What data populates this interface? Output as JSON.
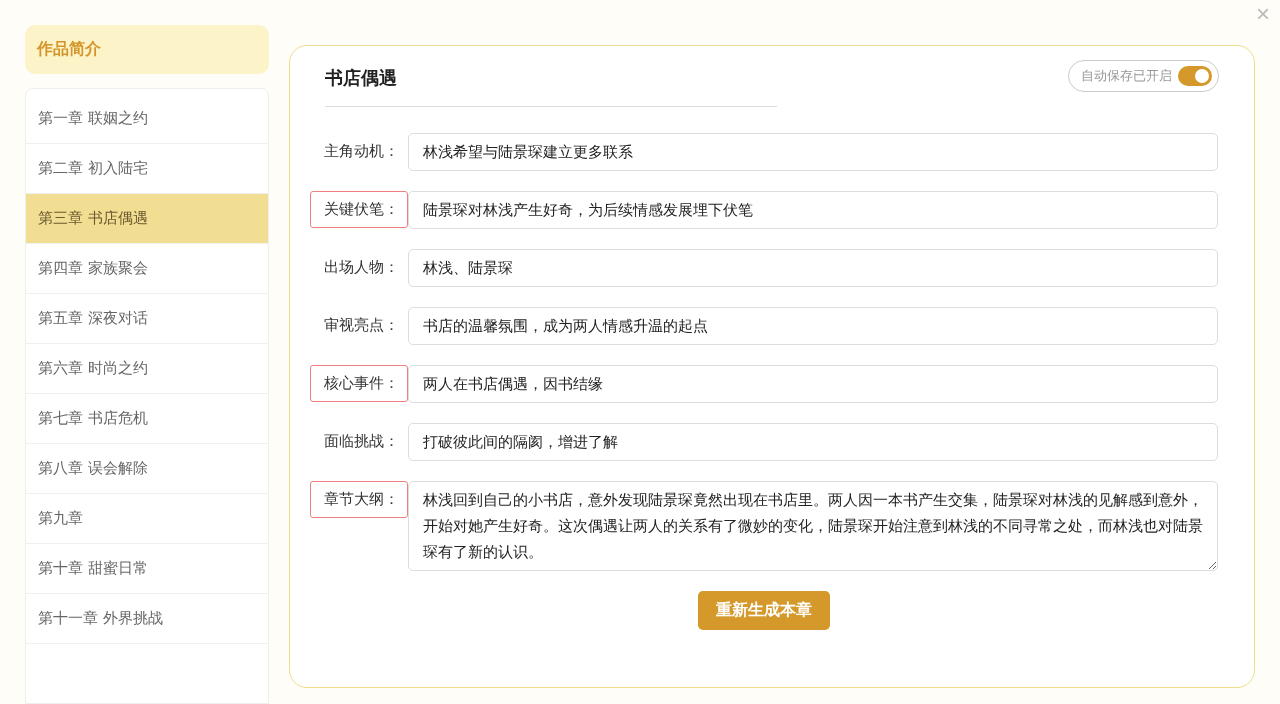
{
  "close_button": "×",
  "sidebar": {
    "header": {
      "label": "作品简介",
      "selected": false
    },
    "chapters": [
      {
        "label": "第一章 联姻之约",
        "selected": false
      },
      {
        "label": "第二章 初入陆宅",
        "selected": false
      },
      {
        "label": "第三章 书店偶遇",
        "selected": true
      },
      {
        "label": "第四章 家族聚会",
        "selected": false
      },
      {
        "label": "第五章 深夜对话",
        "selected": false
      },
      {
        "label": "第六章 时尚之约",
        "selected": false
      },
      {
        "label": "第七章 书店危机",
        "selected": false
      },
      {
        "label": "第八章 误会解除",
        "selected": false
      },
      {
        "label": "第九章",
        "selected": false
      },
      {
        "label": "第十章 甜蜜日常",
        "selected": false
      },
      {
        "label": "第十一章 外界挑战",
        "selected": false
      }
    ]
  },
  "editor": {
    "title": "书店偶遇",
    "autosave": {
      "label": "自动保存已开启",
      "on": true
    },
    "fields": [
      {
        "kind": "input",
        "label": "主角动机：",
        "highlighted": false,
        "value": "林浅希望与陆景琛建立更多联系"
      },
      {
        "kind": "input",
        "label": "关键伏笔：",
        "highlighted": true,
        "value": "陆景琛对林浅产生好奇，为后续情感发展埋下伏笔"
      },
      {
        "kind": "input",
        "label": "出场人物：",
        "highlighted": false,
        "value": "林浅、陆景琛"
      },
      {
        "kind": "input",
        "label": "审视亮点：",
        "highlighted": false,
        "value": "书店的温馨氛围，成为两人情感升温的起点"
      },
      {
        "kind": "input",
        "label": "核心事件：",
        "highlighted": true,
        "value": "两人在书店偶遇，因书结缘"
      },
      {
        "kind": "input",
        "label": "面临挑战：",
        "highlighted": false,
        "value": "打破彼此间的隔阂，增进了解"
      },
      {
        "kind": "textarea",
        "label": "章节大纲：",
        "highlighted": true,
        "value": "林浅回到自己的小书店，意外发现陆景琛竟然出现在书店里。两人因一本书产生交集，陆景琛对林浅的见解感到意外，开始对她产生好奇。这次偶遇让两人的关系有了微妙的变化，陆景琛开始注意到林浅的不同寻常之处，而林浅也对陆景琛有了新的认识。"
      }
    ],
    "button": "重新生成本章"
  }
}
